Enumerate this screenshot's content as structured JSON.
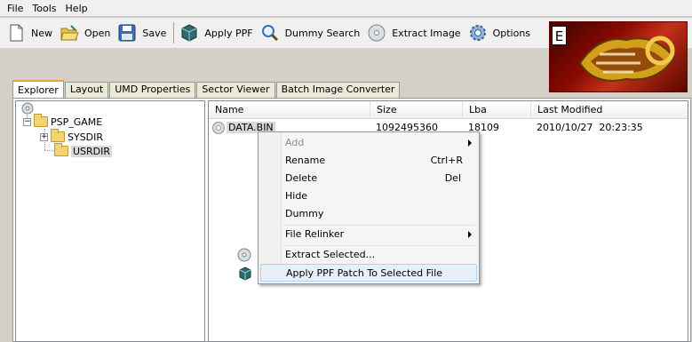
{
  "menubar": {
    "items": [
      "File",
      "Tools",
      "Help"
    ]
  },
  "toolbar": {
    "buttons": [
      {
        "label": "New",
        "icon": "new-file-icon"
      },
      {
        "label": "Open",
        "icon": "open-folder-icon"
      },
      {
        "label": "Save",
        "icon": "save-disk-icon"
      },
      {
        "label": "Apply PPF",
        "icon": "ppf-cube-icon"
      },
      {
        "label": "Dummy Search",
        "icon": "magnifier-icon"
      },
      {
        "label": "Extract Image",
        "icon": "disc-icon"
      },
      {
        "label": "Options",
        "icon": "gear-icon"
      }
    ]
  },
  "logo": {
    "box_letter": "E"
  },
  "tabs": [
    "Explorer",
    "Layout",
    "UMD Properties",
    "Sector Viewer",
    "Batch Image Converter"
  ],
  "tree": {
    "root": "PSP_GAME",
    "children": [
      "SYSDIR",
      "USRDIR"
    ],
    "selected": "USRDIR"
  },
  "listview": {
    "columns": [
      "Name",
      "Size",
      "Lba",
      "Last Modified"
    ],
    "rows": [
      {
        "name": "DATA.BIN",
        "size": "1092495360",
        "lba": "18109",
        "modified": "2010/10/27  20:23:35"
      }
    ]
  },
  "context_menu": {
    "items": [
      {
        "label": "Add",
        "shortcut": "",
        "disabled": true,
        "submenu": true
      },
      {
        "label": "Rename",
        "shortcut": "Ctrl+R"
      },
      {
        "label": "Delete",
        "shortcut": "Del"
      },
      {
        "label": "Hide",
        "shortcut": ""
      },
      {
        "label": "Dummy",
        "shortcut": ""
      },
      {
        "label": "File Relinker",
        "shortcut": "",
        "submenu": true
      },
      {
        "label": "Extract Selected...",
        "shortcut": ""
      },
      {
        "label": "Apply PPF Patch To Selected File",
        "shortcut": ""
      }
    ]
  },
  "colors": {
    "tab_accent": "#e8a33c",
    "folder": "#f2d473",
    "menu_highlight": "#e8eff7"
  }
}
